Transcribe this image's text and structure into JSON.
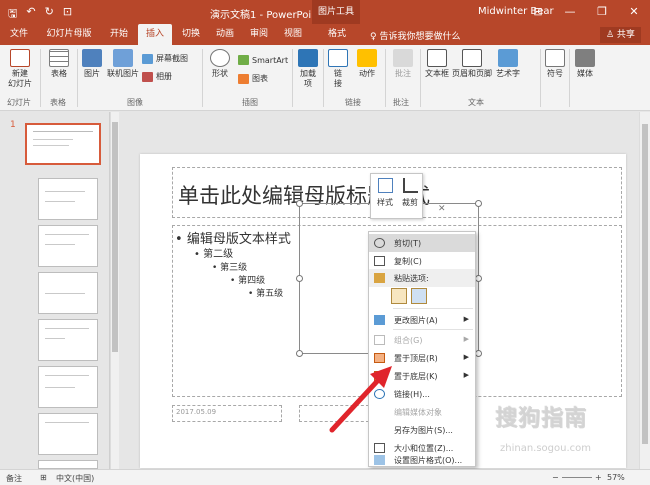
{
  "titlebar": {
    "qat_save": "🖫",
    "qat_undo": "↶",
    "qat_redo": "↻",
    "qat_present": "⊡",
    "title": "演示文稿1  -  PowerPoint",
    "context_tab": "图片工具",
    "user": "Midwinter Bear",
    "ribbon_display": "⊟",
    "minimize": "—",
    "restore": "❐",
    "close": "✕"
  },
  "tabs": [
    {
      "label": "文件"
    },
    {
      "label": "幻灯片母版"
    },
    {
      "label": "开始"
    },
    {
      "label": "插入"
    },
    {
      "label": "切换"
    },
    {
      "label": "动画"
    },
    {
      "label": "审阅"
    },
    {
      "label": "视图"
    },
    {
      "label": "格式"
    }
  ],
  "tell_me": "♀ 告诉我你想要做什么",
  "share": "♙ 共享",
  "ribbon": {
    "new_slide": "新建\n幻灯片",
    "table": "表格",
    "picture": "图片",
    "online_picture": "联机图片",
    "screenshot": "屏幕截图",
    "album": "相册",
    "shapes": "形状",
    "smartart": "SmartArt",
    "chart": "图表",
    "addins": "加载\n项",
    "link": "链\n接",
    "action": "动作",
    "comment": "批注",
    "textbox": "文本框",
    "header_footer": "页眉和页脚",
    "wordart": "艺术字",
    "symbol": "符号",
    "media": "媒体",
    "groups": {
      "slides": "幻灯片",
      "tables": "表格",
      "images": "图像",
      "illustrations": "插图",
      "links": "链接",
      "comments": "批注",
      "text": "文本"
    }
  },
  "thumbs": {
    "first_number": "1"
  },
  "slide": {
    "title": "单击此处编辑母版标题样式",
    "bullets": [
      "编辑母版文本样式",
      "第二级",
      "第三级",
      "第四级",
      "第五级"
    ],
    "date": "2017.05.09"
  },
  "minitoolbar": {
    "style": "样式",
    "crop": "裁剪"
  },
  "context_menu": {
    "cut": "剪切(T)",
    "copy": "复制(C)",
    "paste_options": "粘贴选项:",
    "change_picture": "更改图片(A)",
    "group": "组合(G)",
    "bring_front": "置于顶层(R)",
    "send_back": "置于底层(K)",
    "link": "链接(H)...",
    "edit_media": "编辑媒体对象",
    "save_as_picture": "另存为图片(S)...",
    "size_position": "大小和位置(Z)...",
    "format_picture": "设置图片格式(O)..."
  },
  "status": {
    "notes": "备注",
    "page": "⊞",
    "language": "中文(中国)",
    "zoom": "57%",
    "zoom_minus": "−",
    "zoom_plus": "+"
  },
  "watermark": {
    "brand": "搜狗指南",
    "url": "zhinan.sogou.com"
  },
  "colors": {
    "accent": "#b7472a",
    "arrow": "#e0242b"
  }
}
